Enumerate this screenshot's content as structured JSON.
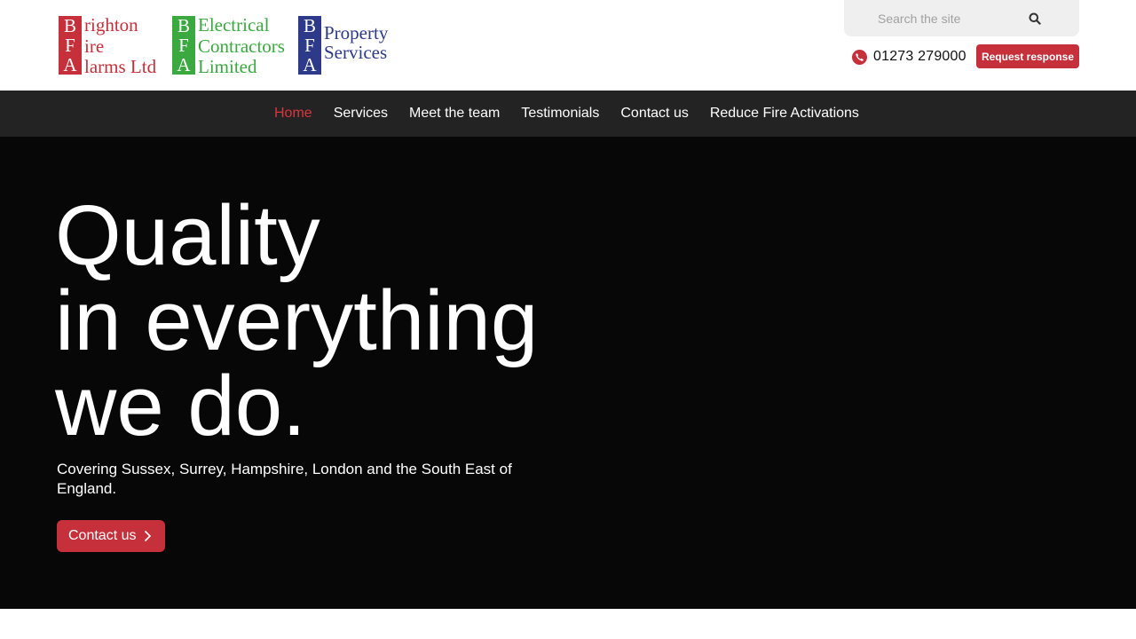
{
  "logos": {
    "bfa": {
      "initials": [
        "B",
        "F",
        "A"
      ],
      "words": [
        "righton",
        "ire",
        "larms Ltd"
      ],
      "color": "#c5303b"
    },
    "electrical": {
      "initials": [
        "B",
        "F",
        "A"
      ],
      "words": [
        "Electrical",
        "Contractors",
        "Limited"
      ],
      "color": "#3aa93f"
    },
    "property": {
      "initials": [
        "B",
        "F",
        "A"
      ],
      "words": [
        "Property",
        "Services"
      ],
      "color": "#2c3a89"
    }
  },
  "search": {
    "placeholder": "Search the site",
    "icon": "search-icon"
  },
  "contact": {
    "phone": "01273 279000",
    "phone_icon": "phone-icon",
    "request_label": "Request response"
  },
  "nav": {
    "items": [
      {
        "label": "Home",
        "active": true
      },
      {
        "label": "Services",
        "active": false
      },
      {
        "label": "Meet the team",
        "active": false
      },
      {
        "label": "Testimonials",
        "active": false
      },
      {
        "label": "Contact us",
        "active": false
      },
      {
        "label": "Reduce Fire Activations",
        "active": false
      }
    ]
  },
  "hero": {
    "headline": [
      "Quality",
      "in everything",
      "we do."
    ],
    "subtitle": "Covering Sussex, Surrey, Hampshire, London and the South East of England.",
    "cta_label": "Contact us",
    "cta_icon": "chevron-right-icon"
  },
  "colors": {
    "accent": "#c5303b",
    "nav_bg": "#232323",
    "hero_bg": "#070707",
    "nav_active": "#d8363f"
  }
}
